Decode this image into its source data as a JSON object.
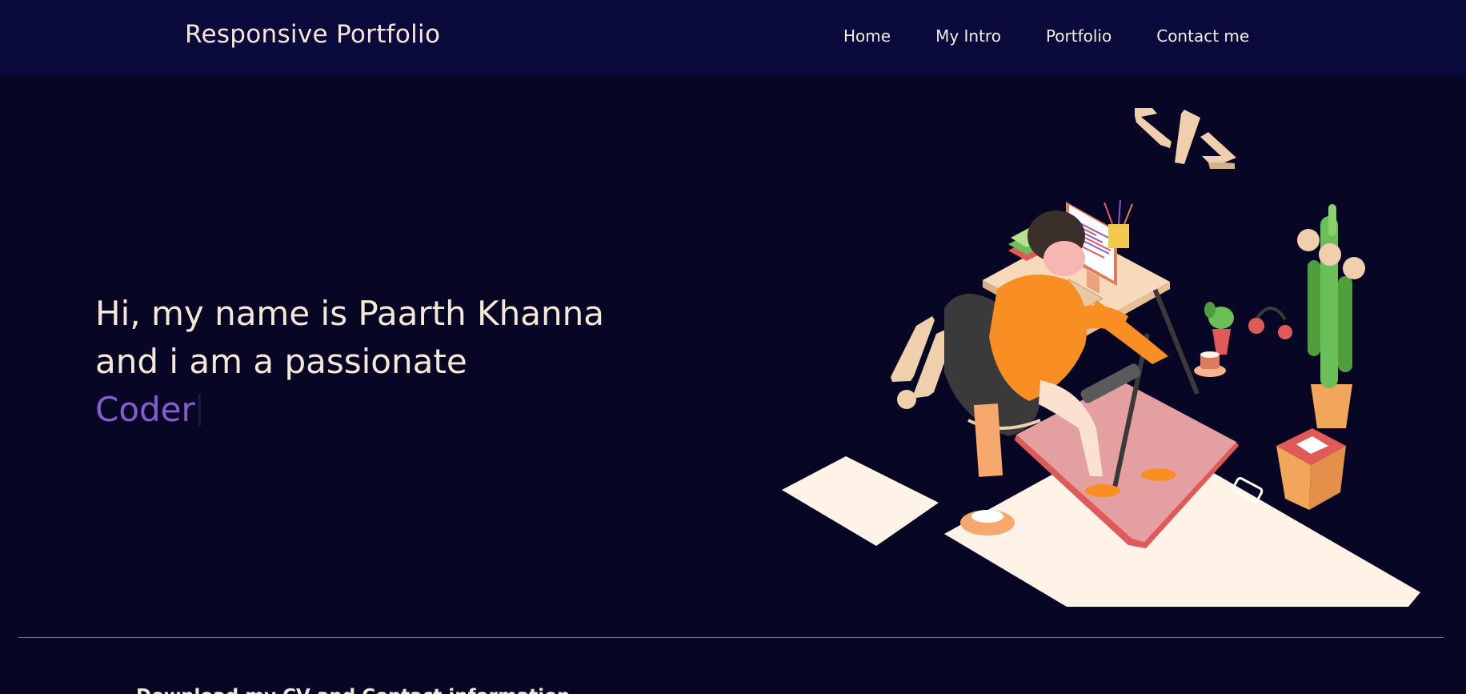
{
  "navbar": {
    "brand": "Responsive Portfolio",
    "links": [
      {
        "label": "Home"
      },
      {
        "label": "My Intro"
      },
      {
        "label": "Portfolio"
      },
      {
        "label": "Contact me"
      }
    ]
  },
  "hero": {
    "line1": "Hi, my name is Paarth Khanna",
    "line2": "and i am a passionate",
    "role": "Coder"
  },
  "footer": {
    "heading": "Download my CV and Contact information"
  },
  "colors": {
    "background": "#070624",
    "navbar": "#0b0a3d",
    "text": "#f6e8d8",
    "accent": "#8a5ad0"
  },
  "illustration": {
    "icon": "developer-workspace-illustration",
    "code_tag": "</>"
  }
}
